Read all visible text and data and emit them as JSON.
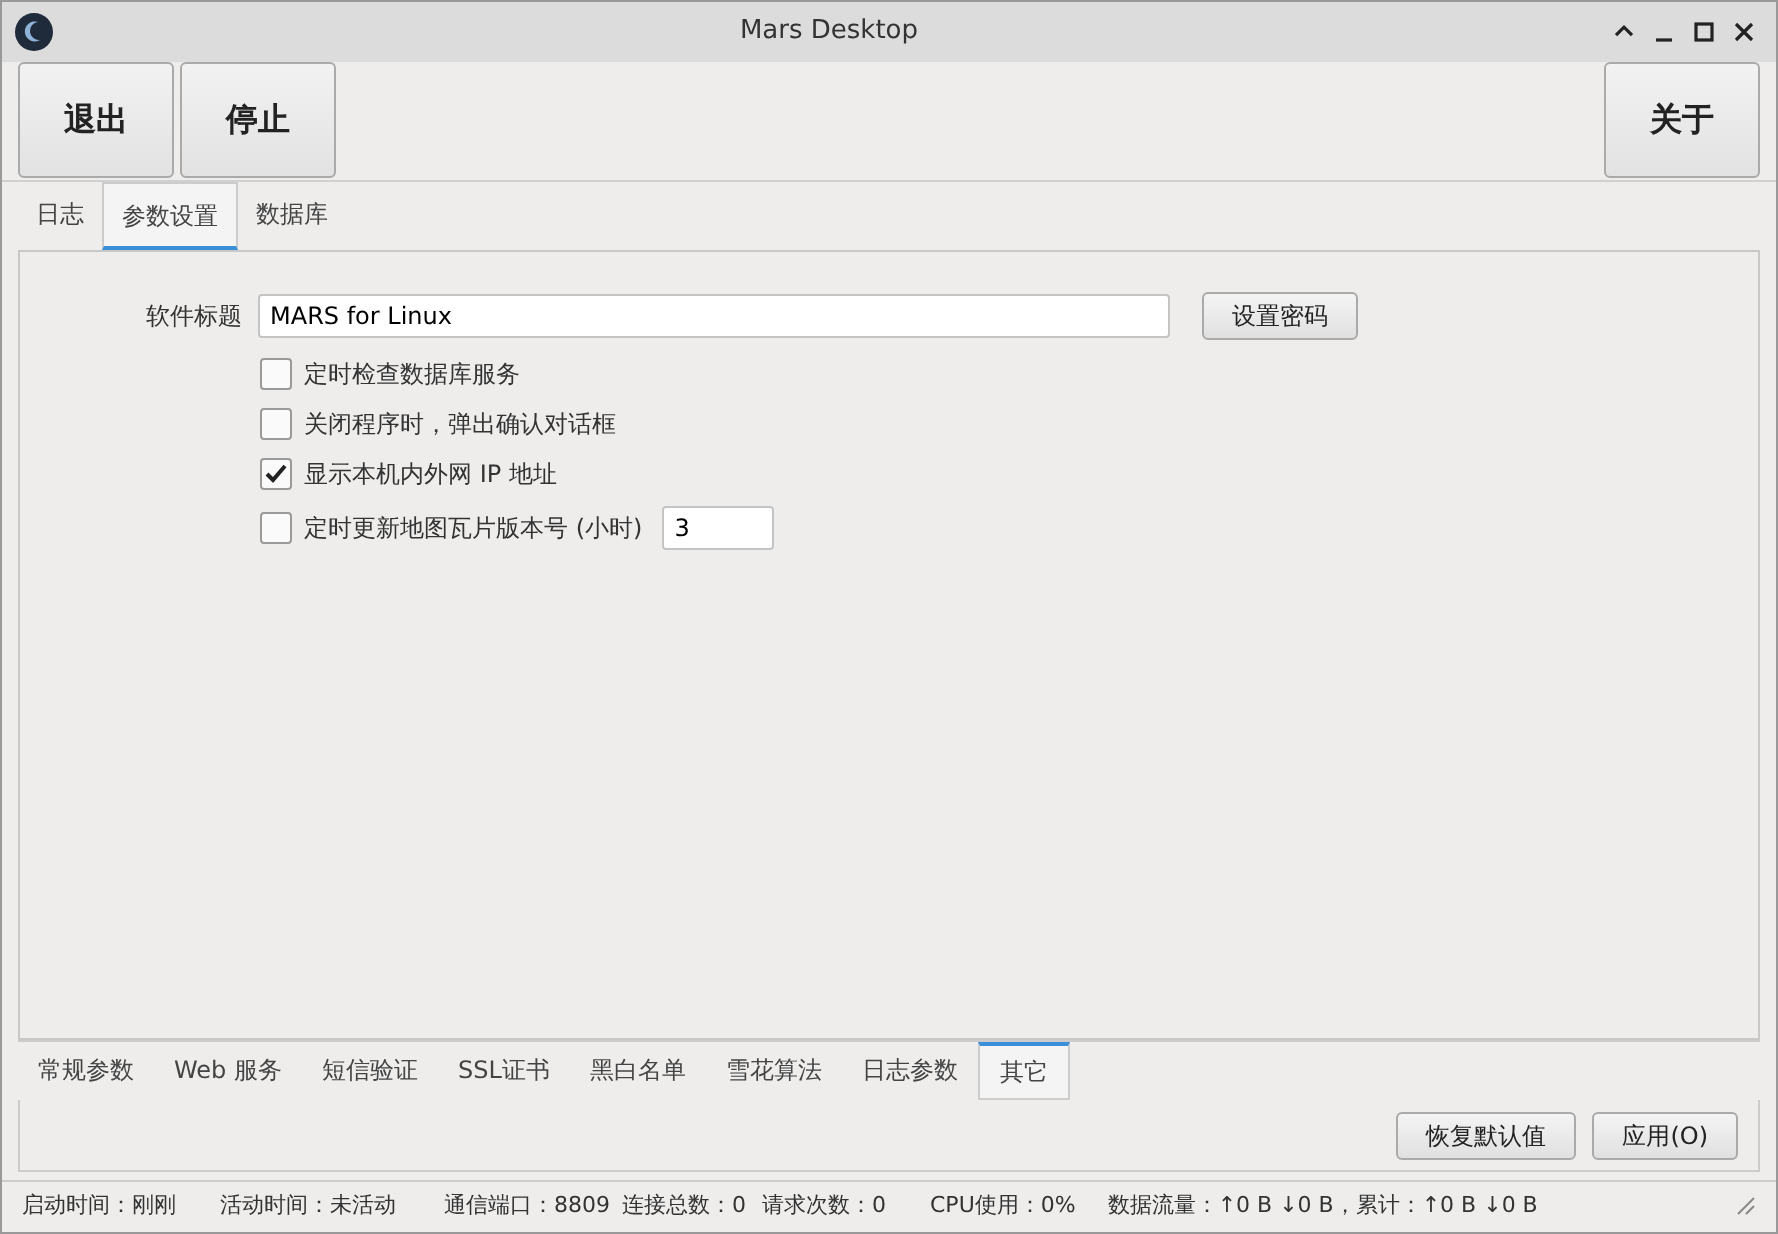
{
  "window": {
    "title": "Mars Desktop"
  },
  "toolbar": {
    "left_buttons": [
      "退出",
      "停止"
    ],
    "right_buttons": [
      "关于"
    ]
  },
  "top_tabs": [
    {
      "label": "日志",
      "selected": false
    },
    {
      "label": "参数设置",
      "selected": true
    },
    {
      "label": "数据库",
      "selected": false
    }
  ],
  "settings": {
    "title_label": "软件标题",
    "title_value": "MARS for Linux",
    "password_button": "设置密码",
    "options": [
      {
        "label": "定时检查数据库服务",
        "checked": false
      },
      {
        "label": "关闭程序时，弹出确认对话框",
        "checked": false
      },
      {
        "label": "显示本机内外网 IP 地址",
        "checked": true
      },
      {
        "label": "定时更新地图瓦片版本号 (小时)",
        "checked": false,
        "value": "3"
      }
    ]
  },
  "bottom_tabs": [
    {
      "label": "常规参数",
      "selected": false
    },
    {
      "label": "Web 服务",
      "selected": false
    },
    {
      "label": "短信验证",
      "selected": false
    },
    {
      "label": "SSL证书",
      "selected": false
    },
    {
      "label": "黑白名单",
      "selected": false
    },
    {
      "label": "雪花算法",
      "selected": false
    },
    {
      "label": "日志参数",
      "selected": false
    },
    {
      "label": "其它",
      "selected": true
    }
  ],
  "actions": [
    "恢复默认值",
    "应用(O)"
  ],
  "status_bar": [
    "启动时间：刚刚",
    "活动时间：未活动",
    "通信端口：8809",
    "连接总数：0",
    "请求次数：0",
    "CPU使用：0%",
    "数据流量：↑0 B ↓0 B，累计：↑0 B ↓0 B"
  ]
}
